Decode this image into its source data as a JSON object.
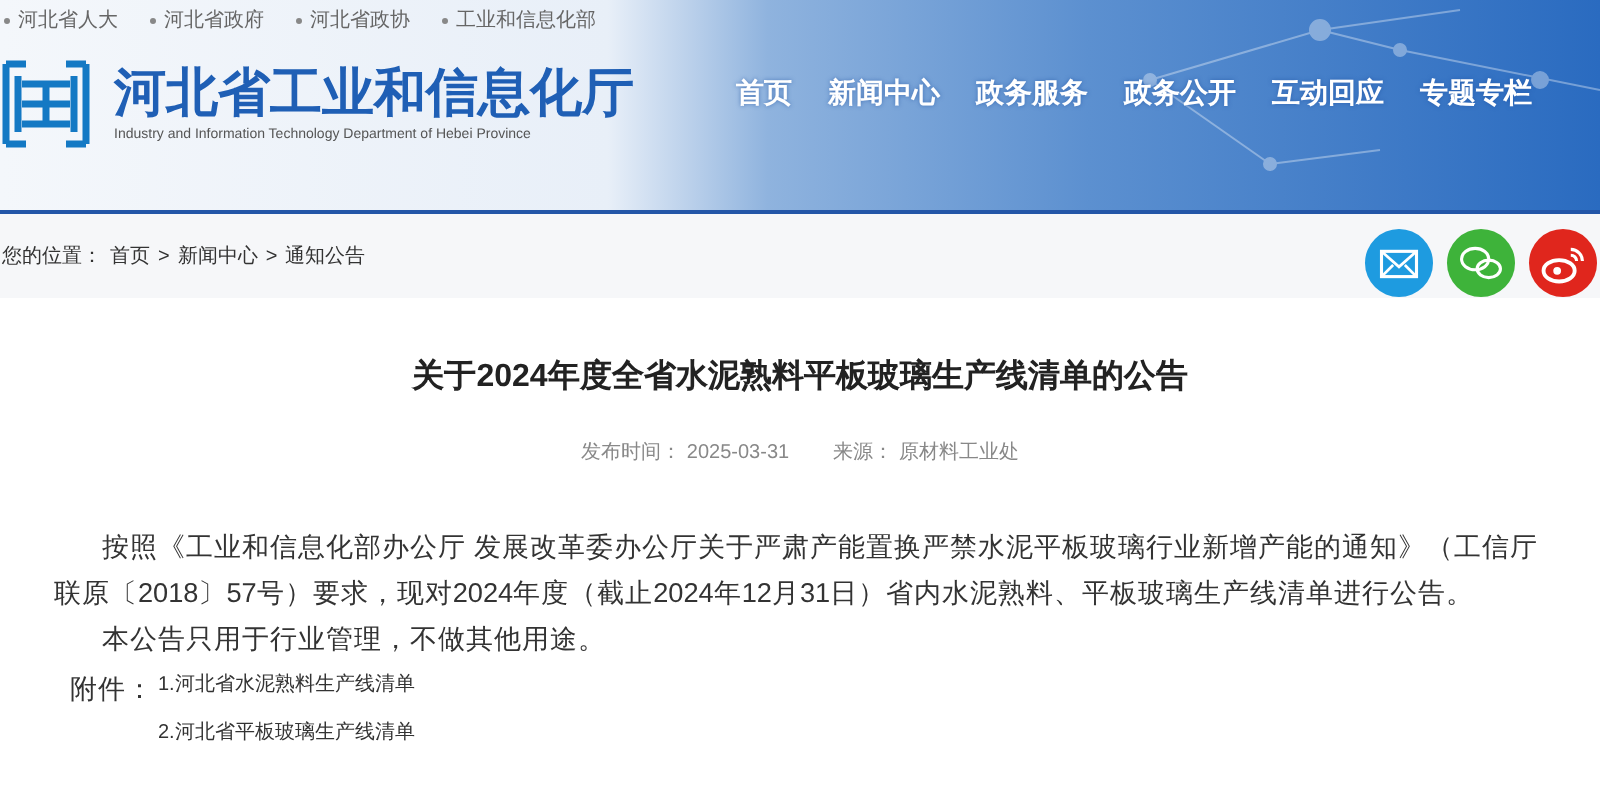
{
  "top_links": [
    "河北省人大",
    "河北省政府",
    "河北省政协",
    "工业和信息化部"
  ],
  "site": {
    "title": "河北省工业和信息化厅",
    "subtitle": "Industry and Information Technology Department of Hebei Province"
  },
  "nav": [
    "首页",
    "新闻中心",
    "政务服务",
    "政务公开",
    "互动回应",
    "专题专栏"
  ],
  "breadcrumb": {
    "label": "您的位置：",
    "items": [
      "首页",
      "新闻中心",
      "通知公告"
    ],
    "separator": ">"
  },
  "share": [
    {
      "kind": "mail",
      "color": "#1e9be0"
    },
    {
      "kind": "wechat",
      "color": "#3eb33a"
    },
    {
      "kind": "weibo",
      "color": "#e0261d"
    }
  ],
  "article": {
    "title": "关于2024年度全省水泥熟料平板玻璃生产线清单的公告",
    "date_label": "发布时间：",
    "date": "2025-03-31",
    "source_label": "来源：",
    "source": "原材料工业处",
    "paragraphs": [
      "按照《工业和信息化部办公厅 发展改革委办公厅关于严肃产能置换严禁水泥平板玻璃行业新增产能的通知》（工信厅联原〔2018〕57号）要求，现对2024年度（截止2024年12月31日）省内水泥熟料、平板玻璃生产线清单进行公告。",
      "本公告只用于行业管理，不做其他用途。"
    ],
    "attachments_label": "附件：",
    "attachments": [
      "1.河北省水泥熟料生产线清单",
      "2.河北省平板玻璃生产线清单"
    ]
  }
}
